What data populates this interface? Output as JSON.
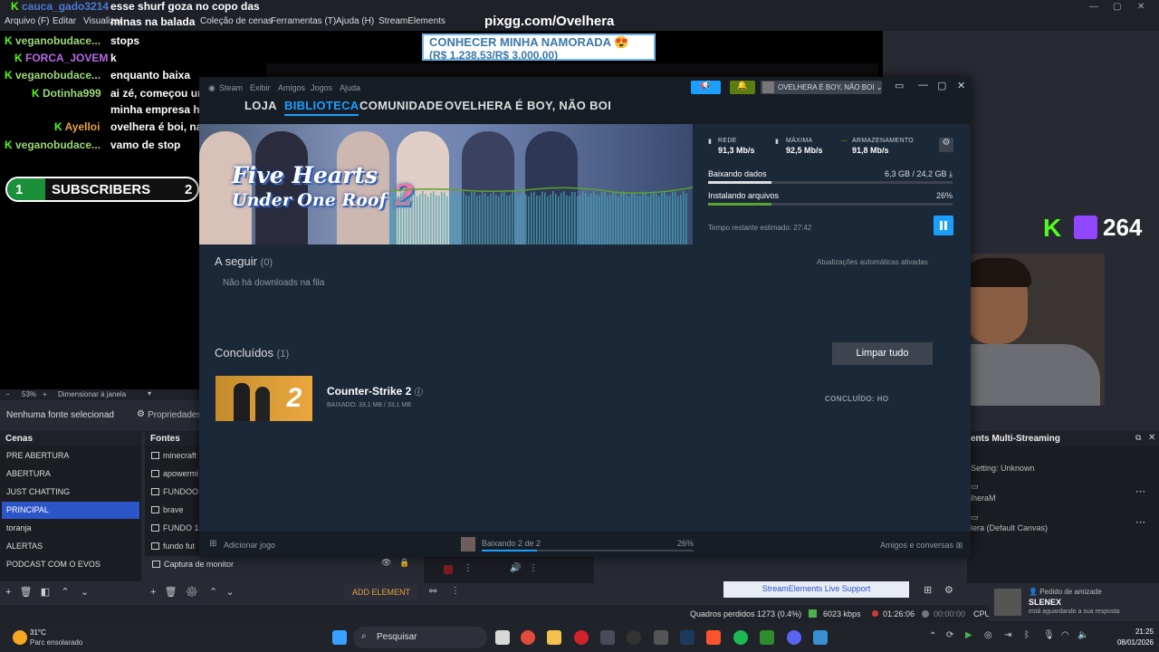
{
  "obs": {
    "menu": [
      "Arquivo (F)",
      "Editar",
      "Visualizar",
      "Coleção de cenas",
      "Ferramentas (T)",
      "Ajuda (H)",
      "StreamElements"
    ],
    "preview_bar": {
      "zoom": "53%",
      "fit": "Dimensionar à janela"
    },
    "no_source": "Nenhuma fonte selecionad",
    "properties": "Propriedades",
    "scenes_title": "Cenas",
    "scenes": [
      "PRE ABERTURA",
      "ABERTURA",
      "JUST CHATTING",
      "PRINCIPAL",
      "toranja",
      "ALERTAS",
      "PODCAST COM O EVOS"
    ],
    "active_scene": "PRINCIPAL",
    "sources_title": "Fontes",
    "sources": [
      "minecraft",
      "apowermi",
      "FUNDOO",
      "brave",
      "FUNDO 1",
      "fundo fut"
    ],
    "capture_source": "Captura de monitor",
    "add_element": "ADD ELEMENT",
    "multistream_title": "ents Multi-Streaming",
    "ms_setting": "Setting: Unknown",
    "ms_rows": [
      "lheraM",
      "lera (Default Canvas)"
    ],
    "se_support": "StreamElements Live Support",
    "status": {
      "dropped": "Quadros perdidos 1273 (0.4%)",
      "kbps": "6023 kbps",
      "live_time": "01:26:06",
      "rec_time": "00:00:00",
      "cpu": "CPU"
    }
  },
  "overlay": {
    "site": "pixgg.com/Ovelhera",
    "goal_line1": "CONHECER MINHA NAMORADA 😍",
    "goal_line2": "(R$ 1.238,53/R$ 3.000,00)",
    "chat": [
      {
        "user": "cauca_gado3214",
        "msg": "esse shurf goza no copo das"
      },
      {
        "user": "",
        "msg": "minas na balada"
      },
      {
        "user": "veganobudace...",
        "msg": "stops"
      },
      {
        "user": "FORCA_JOVEM",
        "msg": "k"
      },
      {
        "user": "veganobudace...",
        "msg": "enquanto baixa"
      },
      {
        "user": "Dotinha999",
        "msg": "ai zé, começou um cara na"
      },
      {
        "user": "",
        "msg": "minha empresa hj aí de ipatinga"
      },
      {
        "user": "Ayelloi",
        "msg": "ovelhera é boi, nao boi"
      },
      {
        "user": "veganobudace...",
        "msg": "vamo de stop"
      }
    ],
    "sub_goal": {
      "left": "1",
      "label": "SUBSCRIBERS",
      "right": "2"
    },
    "viewer_count": "264",
    "kick_letter": "K"
  },
  "steam": {
    "menu": [
      "Steam",
      "Exibir",
      "Amigos",
      "Jogos",
      "Ajuda"
    ],
    "nav": [
      "LOJA",
      "BIBLIOTECA",
      "COMUNIDADE",
      "OVELHERA É BOY, NÃO BOI"
    ],
    "active_nav": "BIBLIOTECA",
    "username": "OVELHERA É BOY, NÃO BOI",
    "game_title_line1": "Five Hearts",
    "game_title_line2": "Under One Roof",
    "game_title_num": "2",
    "stats": {
      "network_label": "REDE",
      "network_value": "91,3 Mb/s",
      "peak_label": "MÁXIMA",
      "peak_value": "92,5 Mb/s",
      "disk_label": "ARMAZENAMENTO",
      "disk_value": "91,8 Mb/s"
    },
    "downloading_label": "Baixando dados",
    "downloading_value": "6,3 GB / 24,2 GB",
    "downloading_fraction": 0.26,
    "installing_label": "Instalando arquivos",
    "installing_value": "26%",
    "installing_fraction": 0.26,
    "time_left": "Tempo restante estimado: 27:42",
    "queue_title": "A seguir",
    "queue_count": "(0)",
    "auto_updates": "Atualizações automáticas ativadas",
    "queue_empty": "Não há downloads na fila",
    "completed_title": "Concluídos",
    "completed_count": "(1)",
    "clear_all": "Limpar tudo",
    "completed_game": "Counter-Strike 2",
    "completed_info": "BAIXADO: 33,1 MB / 33,1 MB",
    "completed_status": "CONCLUÍDO: HO",
    "add_game": "Adicionar jogo",
    "footer_downloading": "Baixando 2 de 2",
    "footer_pct": "26%",
    "footer_fraction": 0.26,
    "friends_chat": "Amigos e conversas"
  },
  "toast": {
    "line1": "Pedido de amizade",
    "line2": "SLENEX",
    "line3": "está aguardando a sua resposta"
  },
  "taskbar": {
    "weather_temp": "31°C",
    "weather_desc": "Parc ensolarado",
    "search": "Pesquisar",
    "time": "21:25",
    "date": "08/01/2026"
  },
  "colors": {
    "steam_blue": "#1a9fff",
    "kick_green": "#53fc18",
    "obs_active": "#2c55c8"
  }
}
